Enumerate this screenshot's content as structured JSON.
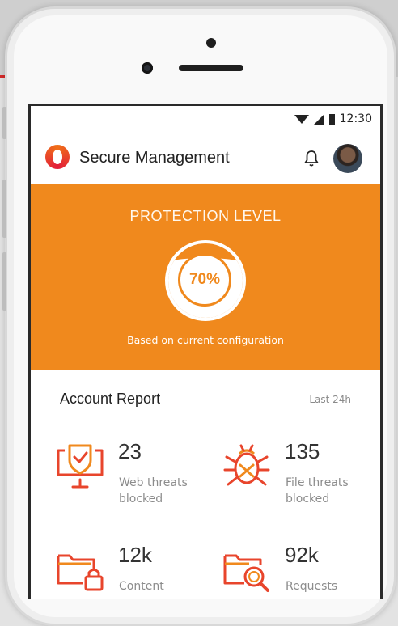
{
  "status_bar": {
    "time": "12:30"
  },
  "app": {
    "title": "Secure Management",
    "bell_icon": "bell-icon",
    "avatar": "user-avatar"
  },
  "protection": {
    "title": "PROTECTION LEVEL",
    "percent_label": "70%",
    "level": 0.7,
    "subtitle": "Based on current configuration",
    "color": "#f0891d"
  },
  "report": {
    "title": "Account Report",
    "range": "Last 24h",
    "stats": [
      {
        "icon": "monitor-shield-icon",
        "value": "23",
        "label": "Web threats blocked"
      },
      {
        "icon": "bug-icon",
        "value": "135",
        "label": "File threats blocked"
      },
      {
        "icon": "folder-lock-icon",
        "value": "12k",
        "label": "Content"
      },
      {
        "icon": "folder-search-icon",
        "value": "92k",
        "label": "Requests"
      }
    ]
  },
  "colors": {
    "accent": "#f0891d",
    "icon_red": "#e8452c",
    "brand_red": "#e21c3a"
  }
}
